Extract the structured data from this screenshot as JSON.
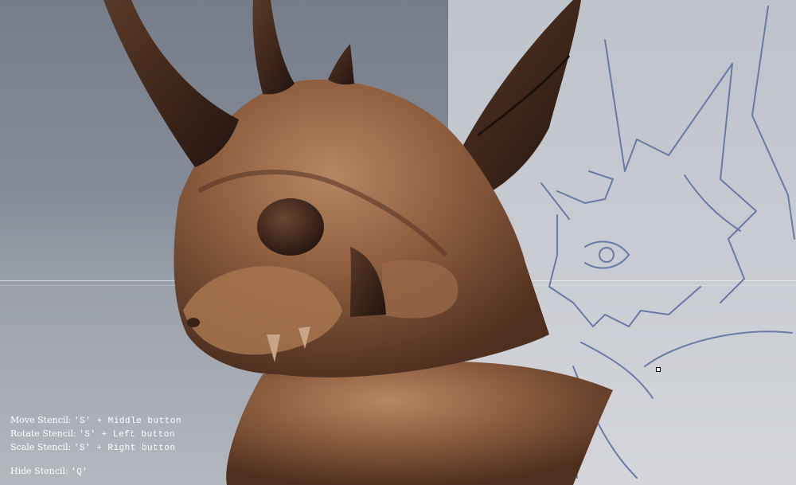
{
  "hud": {
    "move": {
      "label": "Move Stencil: ",
      "keys": "'S' + Middle button"
    },
    "rotate": {
      "label": "Rotate Stencil: ",
      "keys": "'S' + Left button"
    },
    "scale": {
      "label": "Scale Stencil: ",
      "keys": "'S' + Right button"
    },
    "hide": {
      "label": "Hide Stencil: ",
      "keys": "'Q'"
    }
  },
  "colors": {
    "clay": "#8a5a3c",
    "horn": "#3d2519",
    "stencil_line": "#6a7aa6"
  }
}
